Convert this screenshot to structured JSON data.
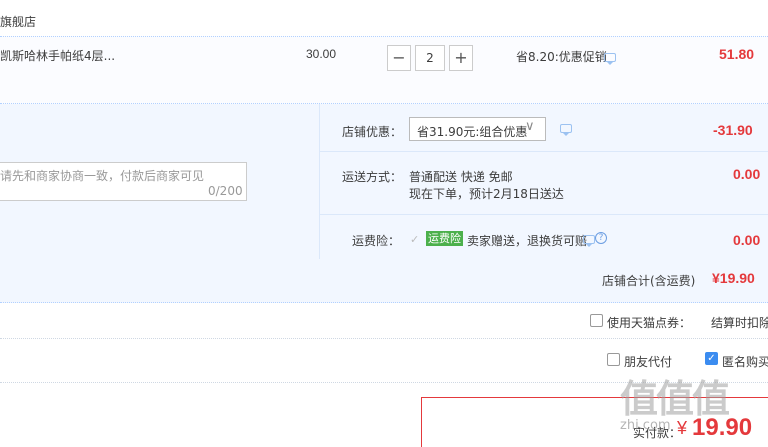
{
  "shop": {
    "name": "旗舰店"
  },
  "item": {
    "title": "凯斯哈林手帕纸4层...",
    "unit_price": "30.00",
    "qty_minus": "−",
    "quantity": "2",
    "qty_plus": "+",
    "discount_note": "省8.20:优惠促销",
    "subtotal": "51.80"
  },
  "message": {
    "placeholder": "请先和商家协商一致，付款后商家可见",
    "counter": "0/200"
  },
  "coupon": {
    "label": "店铺优惠：",
    "selected": "省31.90元:组合优惠",
    "amount": "-31.90"
  },
  "shipping": {
    "label": "运送方式：",
    "method": "普通配送 快递 免邮",
    "date": "现在下单，预计2月18日送达",
    "fee": "0.00"
  },
  "insurance": {
    "label": "运费险：",
    "badge": "运费险",
    "text": "卖家赠送，退换货可赔",
    "help": "?",
    "fee": "0.00"
  },
  "shop_total": {
    "label": "店铺合计(含运费)",
    "value": "¥19.90"
  },
  "points": {
    "label": "使用天猫点券：",
    "note": "结算时扣除"
  },
  "options": {
    "friend_pay": "朋友代付",
    "anonymous": "匿名购买",
    "anonymous_checked": true
  },
  "payment": {
    "label": "实付款：",
    "currency": "¥",
    "amount": "19.90"
  },
  "watermark": {
    "logo": "值值值",
    "url": "zhi.com"
  },
  "colors": {
    "price_red": "#e4393c",
    "accent_blue": "#3b8cf0",
    "panel_bg": "#f2f7ff",
    "badge_green": "#4cb04c"
  }
}
